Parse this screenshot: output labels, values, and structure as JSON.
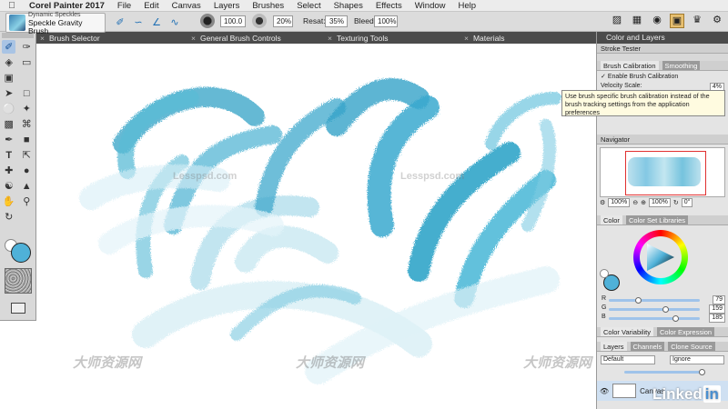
{
  "menubar": {
    "app_name": "Corel Painter 2017",
    "menus": [
      "File",
      "Edit",
      "Canvas",
      "Layers",
      "Brushes",
      "Select",
      "Shapes",
      "Effects",
      "Window",
      "Help"
    ]
  },
  "propbar": {
    "brush_category": "Dynamic Speckles",
    "brush_variant": "Speckle Gravity Brush",
    "size_value": "100.0",
    "opacity_value": "20%",
    "resat_label": "Resat:",
    "resat_value": "35%",
    "bleed_label": "Bleed:",
    "bleed_value": "100%"
  },
  "panel_tabs": [
    "Brush Selector",
    "General Brush Controls",
    "Texturing Tools",
    "Materials"
  ],
  "right_panel": {
    "header": "Color and Layers",
    "stroke_tester": "Stroke Tester",
    "brush_calibration_tab": "Brush Calibration",
    "smoothing_tab": "Smoothing",
    "enable_calibration": "Enable Brush Calibration",
    "velocity_scale_label": "Velocity Scale:",
    "velocity_scale_value": "4%",
    "tooltip": "Use brush specific brush calibration instead of the brush tracking settings from the application preferences",
    "navigator_title": "Navigator",
    "nav_zoom": "100%",
    "nav_zoom2": "100%",
    "nav_angle": "0°",
    "color_tab": "Color",
    "color_set_tab": "Color Set Libraries",
    "r_label": "R",
    "r_value": "79",
    "g_label": "G",
    "g_value": "159",
    "b_label": "B",
    "b_value": "185",
    "color_variability_tab": "Color Variability",
    "color_expression_tab": "Color Expression",
    "layers_tab": "Layers",
    "channels_tab": "Channels",
    "clone_source_tab": "Clone Source",
    "blend_mode": "Default",
    "composite": "Ignore",
    "layer_name": "Canvas"
  },
  "watermarks": {
    "url": "Lesspsd.com",
    "cn": "大师资源网"
  },
  "branding": {
    "linkedin_text": "Linked",
    "linkedin_in": "in"
  },
  "colors": {
    "main_color": "#4FB1D8",
    "secondary_color": "#FFFFFF",
    "accent": "#1F6FB4"
  }
}
